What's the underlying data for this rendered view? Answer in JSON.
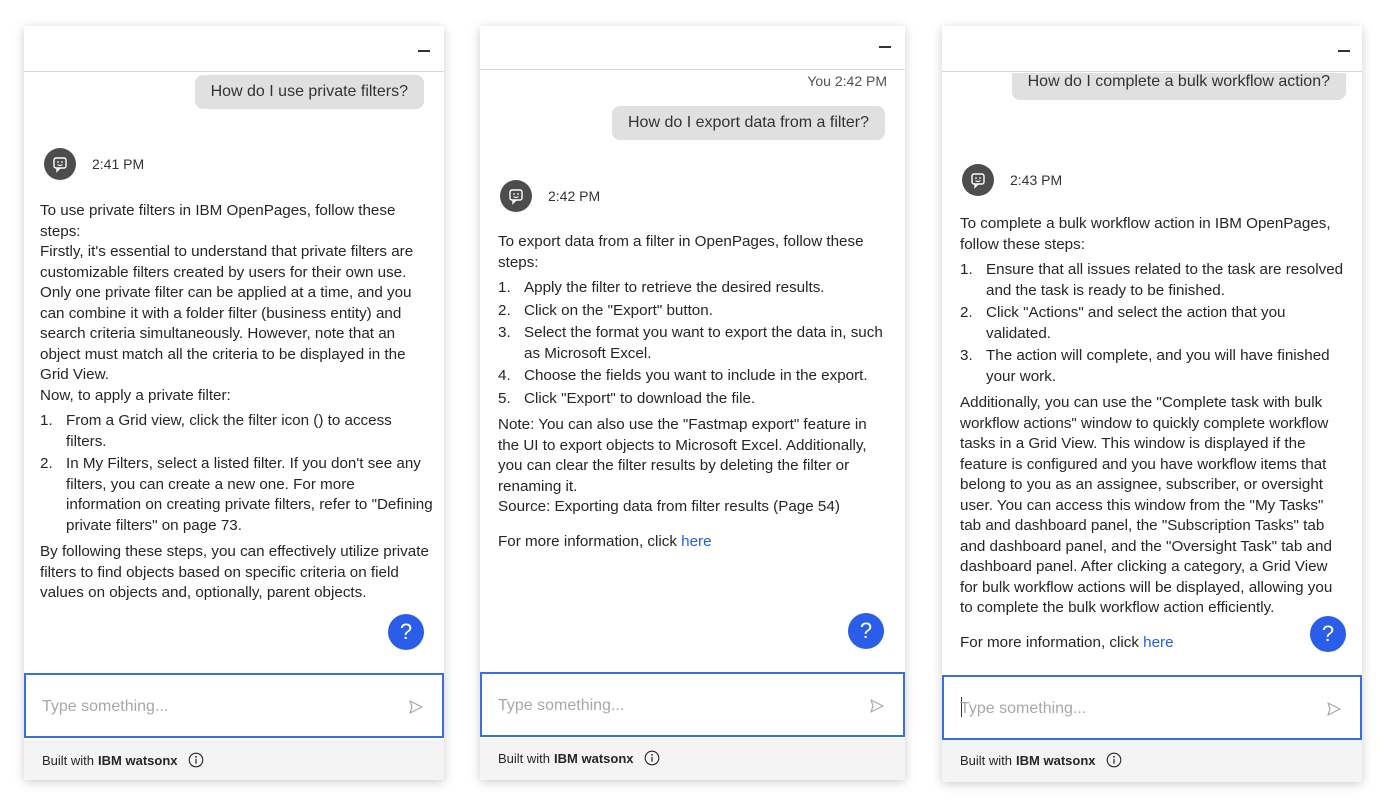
{
  "input": {
    "placeholder": "Type something..."
  },
  "footer": {
    "built_with": "Built with",
    "brand": "IBM watsonx"
  },
  "help_label": "?",
  "panels": [
    {
      "user_question": "How do I use private filters?",
      "bot_time": "2:41 PM",
      "intro_1": "To use private filters in IBM OpenPages, follow these steps:",
      "intro_2": "Firstly, it's essential to understand that private filters are customizable filters created by users for their own use. Only one private filter can be applied at a time, and you can combine it with a folder filter (business entity) and search criteria simultaneously. However, note that an object must match all the criteria to be displayed in the Grid View.",
      "intro_3": "Now, to apply a private filter:",
      "steps": [
        "From a Grid view, click the filter icon () to access filters.",
        "In My Filters, select a listed filter. If you don't see any filters, you can create a new one. For more information on creating private filters, refer to \"Defining private filters\" on page 73."
      ],
      "outro": "By following these steps, you can effectively utilize private filters to find objects based on specific criteria on field values on objects and, optionally, parent objects."
    },
    {
      "user_meta": "You 2:42 PM",
      "user_question": "How do I export data from a filter?",
      "bot_time": "2:42 PM",
      "intro": "To export data from a filter in OpenPages, follow these steps:",
      "steps": [
        "Apply the filter to retrieve the desired results.",
        "Click on the \"Export\" button.",
        "Select the format you want to export the data in, such as Microsoft Excel.",
        "Choose the fields you want to include in the export.",
        "Click \"Export\" to download the file."
      ],
      "note": "Note: You can also use the \"Fastmap export\" feature in the UI to export objects to Microsoft Excel. Additionally, you can clear the filter results by deleting the filter or renaming it.",
      "source": "Source: Exporting data from filter results (Page 54)",
      "more_info": "For more information, click ",
      "more_link": "here"
    },
    {
      "user_question": "How do I complete a bulk workflow action?",
      "bot_time": "2:43 PM",
      "intro": "To complete a bulk workflow action in IBM OpenPages, follow these steps:",
      "steps": [
        "Ensure that all issues related to the task are resolved and the task is ready to be finished.",
        "Click \"Actions\" and select the action that you validated.",
        "The action will complete, and you will have finished your work."
      ],
      "additional": "Additionally, you can use the \"Complete task with bulk workflow actions\" window to quickly complete workflow tasks in a Grid View. This window is displayed if the feature is configured and you have workflow items that belong to you as an assignee, subscriber, or oversight user. You can access this window from the \"My Tasks\" tab and dashboard panel, the \"Subscription Tasks\" tab and dashboard panel, and the \"Oversight Task\" tab and dashboard panel. After clicking a category, a Grid View for bulk workflow actions will be displayed, allowing you to complete the bulk workflow action efficiently.",
      "more_info": "For more information, click ",
      "more_link": "here"
    }
  ]
}
